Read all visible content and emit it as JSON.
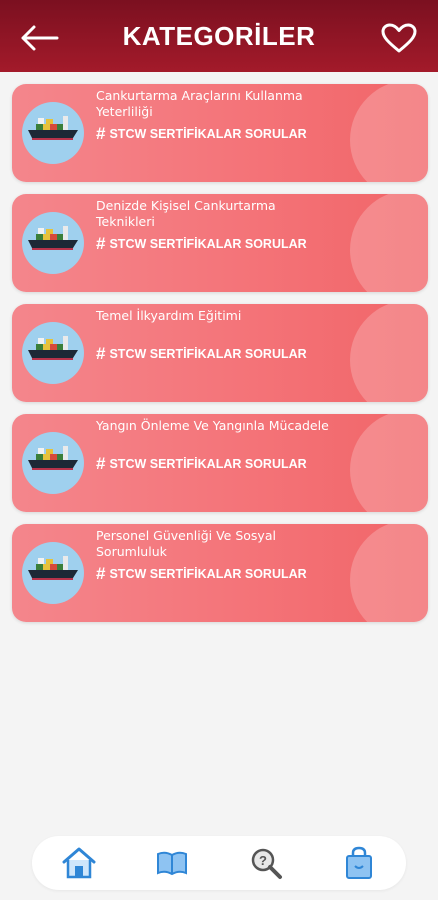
{
  "header": {
    "title": "KATEGORİLER",
    "back_icon": "arrow-left-icon",
    "favorite_icon": "heart-outline-icon"
  },
  "categories": [
    {
      "title": "Cankurtarma Araçlarını Kullanma Yeterliliği",
      "tag": "STCW SERTİFİKALAR SORULAR",
      "icon": "cargo-ship-icon"
    },
    {
      "title": "Denizde Kişisel Cankurtarma Teknikleri",
      "tag": "STCW SERTİFİKALAR SORULAR",
      "icon": "cargo-ship-icon"
    },
    {
      "title": "Temel İlkyardım Eğitimi",
      "tag": "STCW SERTİFİKALAR SORULAR",
      "icon": "cargo-ship-icon"
    },
    {
      "title": "Yangın Önleme Ve Yangınla Mücadele",
      "tag": "STCW SERTİFİKALAR SORULAR",
      "icon": "cargo-ship-icon"
    },
    {
      "title": "Personel Güvenliği Ve Sosyal Sorumluluk",
      "tag": "STCW SERTİFİKALAR SORULAR",
      "icon": "cargo-ship-icon"
    }
  ],
  "bottom_nav": {
    "items": [
      "home-icon",
      "book-icon",
      "search-question-icon",
      "shopping-bag-icon"
    ]
  },
  "colors": {
    "header": "#8e1524",
    "card": "#f47479",
    "background": "#f4f4f4",
    "nav_icon": "#2f86d6"
  }
}
